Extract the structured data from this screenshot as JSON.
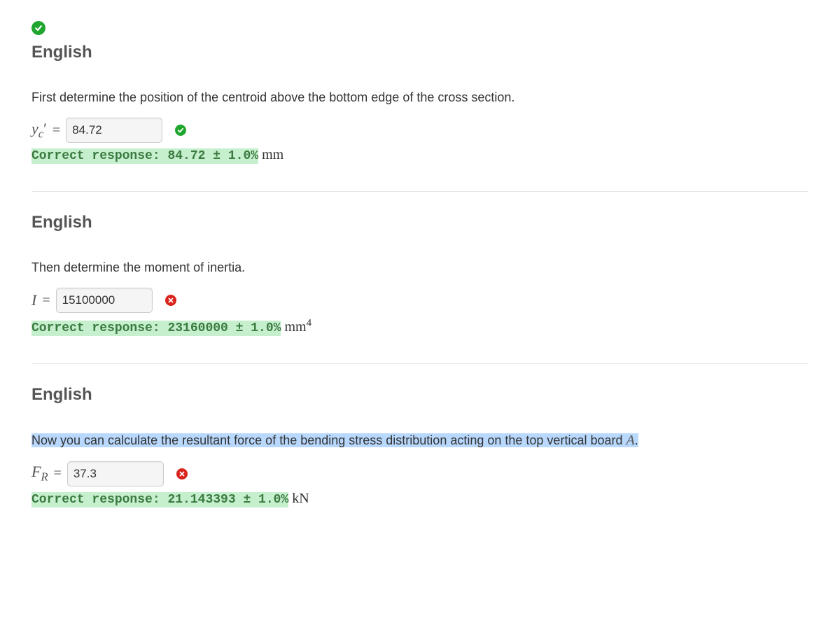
{
  "top_status": "correct",
  "parts": [
    {
      "heading": "English",
      "prompt": "First determine the position of the centroid above the bottom edge of the cross section.",
      "symbol_html": "y<sub>c</sub><span style=\"font-style:normal\">′</span>",
      "value": "84.72",
      "status": "correct",
      "correct_label": "Correct response: ",
      "correct_value": "84.72 ± 1.0%",
      "unit_html": " mm",
      "highlight": false
    },
    {
      "heading": "English",
      "prompt": "Then determine the moment of inertia.",
      "symbol_html": "I",
      "value": "15100000",
      "status": "incorrect",
      "correct_label": "Correct response: ",
      "correct_value": "23160000 ± 1.0%",
      "unit_html": " mm<sup style=\"font-size:0.75em\">4</sup>",
      "highlight": false
    },
    {
      "heading": "English",
      "prompt_pre": "Now you can calculate the resultant force of the bending stress distribution acting on the top vertical board ",
      "prompt_var": "A",
      "prompt_post": ".",
      "symbol_html": "F<sub>R</sub>",
      "value": "37.3",
      "status": "incorrect",
      "correct_label": "Correct response: ",
      "correct_value": "21.143393 ± 1.0%",
      "unit_html": " kN",
      "highlight": true
    }
  ]
}
